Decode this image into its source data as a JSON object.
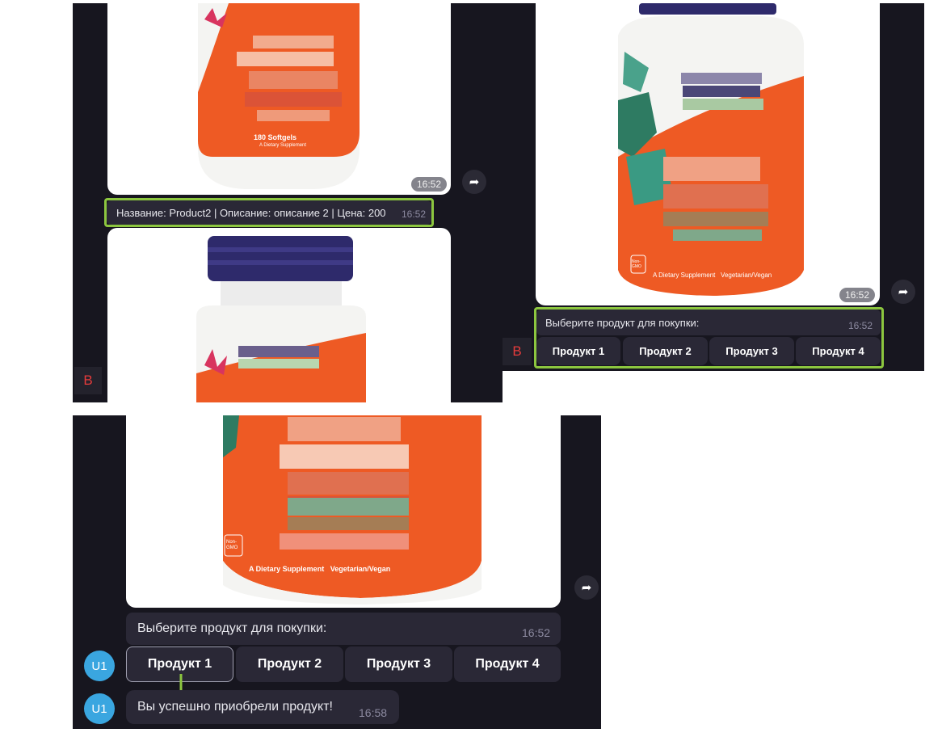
{
  "screenshot_a": {
    "photo_caption": "180 Softgels",
    "photo_subcaption": "A Dietary Supplement",
    "photo_time": "16:52",
    "product_info": "Название: Product2 | Описание: описание 2 | Цена: 200",
    "product_info_time": "16:52",
    "avatar_letter": "B"
  },
  "screenshot_b": {
    "photo_caption": "A Dietary Supplement   Vegetarian/Vegan",
    "photo_badge": "Non-GMO",
    "photo_time": "16:52",
    "prompt": "Выберите продукт для покупки:",
    "prompt_time": "16:52",
    "avatar_letter": "B",
    "buttons": [
      "Продукт 1",
      "Продукт 2",
      "Продукт 3",
      "Продукт 4"
    ]
  },
  "screenshot_c": {
    "photo_caption": "A Dietary Supplement   Vegetarian/Vegan",
    "photo_badge": "Non-GMO",
    "prompt": "Выберите продукт для покупки:",
    "prompt_time": "16:52",
    "buttons": [
      "Продукт 1",
      "Продукт 2",
      "Продукт 3",
      "Продукт 4"
    ],
    "user_avatar": "U1",
    "success_message": "Вы успешно приобрели продукт!",
    "success_time": "16:58"
  },
  "colors": {
    "chat_bg": "#17161f",
    "bubble_bg": "#2a2836",
    "highlight": "#8cc63f",
    "bottle_orange": "#ee5a24",
    "avatar_blue": "#3aa6e0",
    "bot_letter": "#e53b3b"
  },
  "icons": [
    "share-icon",
    "arrow-down-icon"
  ]
}
